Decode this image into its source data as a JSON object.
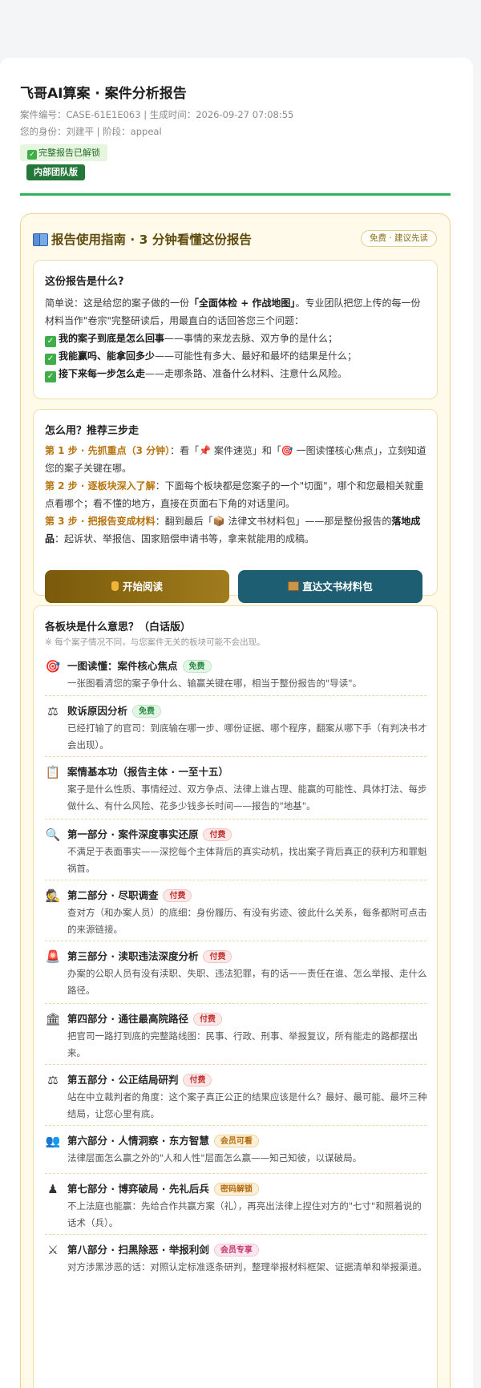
{
  "header": {
    "title": "飞哥AI算案 · 案件分析报告",
    "meta_line1": "案件编号：CASE-61E1E063 | 生成时间：2026-09-27 07:08:55",
    "meta_line2": "您的身份：刘建平    |    阶段：appeal",
    "unlock_badge": "完整报告已解锁",
    "team_badge": "内部团队版"
  },
  "guide": {
    "title": "报告使用指南 · 3 分钟看懂这份报告",
    "badge": "免费 · 建议先读",
    "what": {
      "heading": "这份报告是什么?",
      "intro_prefix": "简单说：这是给您的案子做的一份",
      "intro_bold": "「全面体检 + 作战地图」",
      "intro_suffix": "。专业团队把您上传的每一份材料当作\"卷宗\"完整研读后，用最直白的话回答您三个问题：",
      "q1_bold": "我的案子到底是怎么回事",
      "q1_rest": "——事情的来龙去脉、双方争的是什么；",
      "q2_bold": "我能赢吗、能拿回多少",
      "q2_rest": "——可能性有多大、最好和最坏的结果是什么；",
      "q3_bold": "接下来每一步怎么走",
      "q3_rest": "——走哪条路、准备什么材料、注意什么风险。"
    },
    "how": {
      "heading": "怎么用？推荐三步走",
      "s1_bold": "第 1 步 · 先抓重点（3 分钟）",
      "s1_rest": "：看「📌 案件速览」和「🎯 一图读懂核心焦点」，立刻知道您的案子关键在哪。",
      "s2_bold": "第 2 步 · 逐板块深入了解",
      "s2_rest": "：下面每个板块都是您案子的一个\"切面\"，哪个和您最相关就重点看哪个；看不懂的地方，直接在页面右下角的对话里问。",
      "s3_bold": "第 3 步 · 把报告变成材料",
      "s3_mid": "：翻到最后「📦 法律文书材料包」——那是整份报告的",
      "s3_bold2": "落地成品",
      "s3_rest": "：起诉状、举报信、国家赔偿申请书等，拿来就能用的成稿。",
      "btn_read": "开始阅读",
      "btn_doc": "直达文书材料包"
    },
    "sections": {
      "heading": "各板块是什么意思？（白话版）",
      "note": "※ 每个案子情况不同，与您案件无关的板块可能不会出现。",
      "items": [
        {
          "icon": "🎯",
          "title": "一图读懂：案件核心焦点",
          "tag": "免费",
          "desc": "一张图看清您的案子争什么、输赢关键在哪，相当于整份报告的\"导读\"。"
        },
        {
          "icon": "⚖",
          "title": "败诉原因分析",
          "tag": "免费",
          "desc": "已经打输了的官司：到底输在哪一步、哪份证据、哪个程序，翻案从哪下手（有判决书才会出现）。"
        },
        {
          "icon": "📋",
          "title": "案情基本功（报告主体 · 一至十五）",
          "tag": "",
          "desc": "案子是什么性质、事情经过、双方争点、法律上谁占理、能赢的可能性、具体打法、每步做什么、有什么风险、花多少钱多长时间——报告的\"地基\"。"
        },
        {
          "icon": "🔍",
          "title": "第一部分 · 案件深度事实还原",
          "tag": "付费",
          "desc": "不满足于表面事实——深挖每个主体背后的真实动机，找出案子背后真正的获利方和罪魁祸首。"
        },
        {
          "icon": "🕵",
          "title": "第二部分 · 尽职调查",
          "tag": "付费",
          "desc": "查对方（和办案人员）的底细：身份履历、有没有劣迹、彼此什么关系，每条都附可点击的来源链接。"
        },
        {
          "icon": "🚨",
          "title": "第三部分 · 渎职违法深度分析",
          "tag": "付费",
          "desc": "办案的公职人员有没有渎职、失职、违法犯罪，有的话——责任在谁、怎么举报、走什么路径。"
        },
        {
          "icon": "🏛",
          "title": "第四部分 · 通往最高院路径",
          "tag": "付费",
          "desc": "把官司一路打到底的完整路线图：民事、行政、刑事、举报复议，所有能走的路都摆出来。"
        },
        {
          "icon": "⚖",
          "title": "第五部分 · 公正结局研判",
          "tag": "付费",
          "desc": "站在中立裁判者的角度：这个案子真正公正的结果应该是什么？最好、最可能、最坏三种结局，让您心里有底。"
        },
        {
          "icon": "👥",
          "title": "第六部分 · 人情洞察 · 东方智慧",
          "tag": "会员可看",
          "desc": "法律层面怎么赢之外的\"人和人性\"层面怎么赢——知己知彼，以谋破局。"
        },
        {
          "icon": "♟",
          "title": "第七部分 · 博弈破局 · 先礼后兵",
          "tag": "密码解锁",
          "desc": "不上法庭也能赢：先给合作共赢方案（礼），再亮出法律上捏住对方的\"七寸\"和照着说的话术（兵）。"
        },
        {
          "icon": "⚔",
          "title": "第八部分 · 扫黑除恶 · 举报利剑",
          "tag": "会员专享",
          "desc": "对方涉黑涉恶的话：对照认定标准逐条研判，整理举报材料框架、证据清单和举报渠道。"
        }
      ]
    }
  },
  "colors": {
    "accent_green": "#2db35c",
    "guide_bg": "#fffaea",
    "btn_read": "#8a6a14",
    "btn_doc": "#1d5e72"
  }
}
